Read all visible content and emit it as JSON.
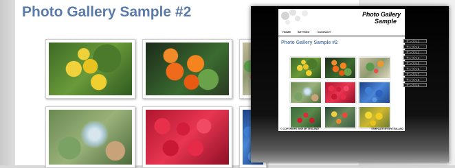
{
  "page": {
    "title": "Photo Gallery Sample #2"
  },
  "gallery": {
    "thumbnails": [
      {
        "name": "yellow-calceolaria",
        "texture": "f-yellow"
      },
      {
        "name": "orange-calceolaria",
        "texture": "f-orange"
      },
      {
        "name": "cactus-flowers",
        "texture": "f-cactus"
      },
      {
        "name": "succulents",
        "texture": "f-succ"
      },
      {
        "name": "red-roses",
        "texture": "f-red"
      },
      {
        "name": "blue-roses",
        "texture": "f-blue"
      }
    ]
  },
  "preview": {
    "logo_line1": "Photo Gallery",
    "logo_line2": "Sample",
    "nav": [
      "HOME",
      "SETTING",
      "CONTACT"
    ],
    "title": "Photo Gallery Sample #2",
    "sidebar_items": [
      "サンプル１",
      "サンプル２",
      "サンプル３",
      "サンプル４",
      "サンプル５",
      "サンプル６",
      "サンプル７",
      "サンプル８",
      "サンプル９"
    ],
    "footer_left": "© COPYRIGHT 2009 MYTEXLAND",
    "footer_right": "TEMPLATE BY MYTEXLAND"
  },
  "colors": {
    "title_blue": "#5b7ba8",
    "preview_bg": "#000000"
  }
}
